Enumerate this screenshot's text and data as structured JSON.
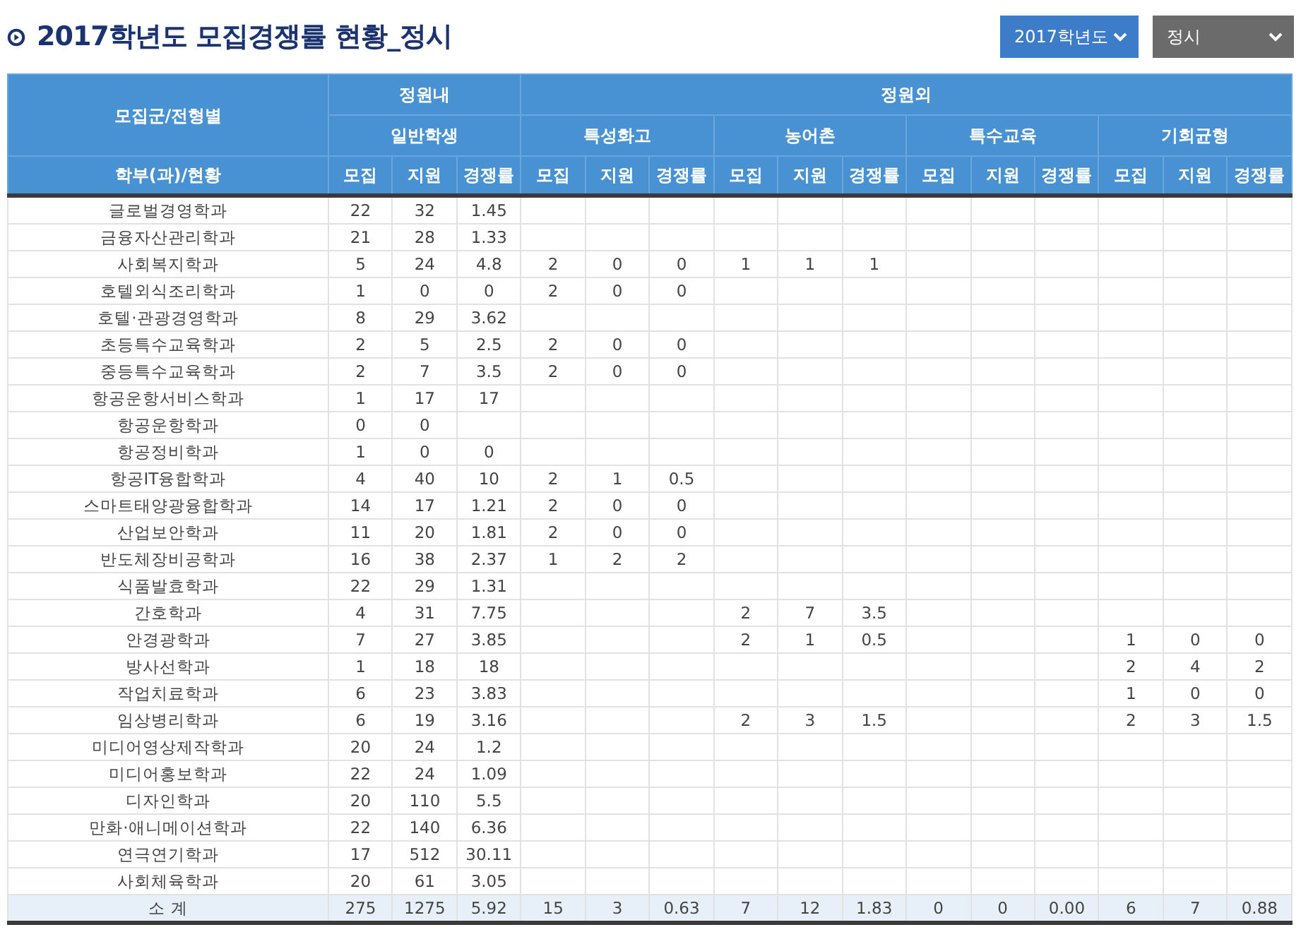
{
  "title": "2017학년도 모집경쟁률 현황_정시",
  "filters": [
    {
      "kind": "year",
      "value": "2017학년도"
    },
    {
      "kind": "type",
      "value": "정시"
    }
  ],
  "table": {
    "corner_top": "모집군/전형별",
    "corner_bottom": "학부(과)/현황",
    "groups": [
      {
        "label": "정원내",
        "subgroups": [
          "일반학생"
        ]
      },
      {
        "label": "정원외",
        "subgroups": [
          "특성화고",
          "농어촌",
          "특수교육",
          "기회균형"
        ]
      }
    ],
    "metrics": [
      "모집",
      "지원",
      "경쟁률",
      "모집",
      "지원",
      "경쟁률",
      "모집",
      "지원",
      "경쟁률",
      "모집",
      "지원",
      "경쟁률",
      "모집",
      "지원",
      "경쟁률"
    ],
    "rows": [
      {
        "name": "글로벌경영학과",
        "cells": [
          "22",
          "32",
          "1.45",
          null,
          null,
          null,
          null,
          null,
          null,
          null,
          null,
          null,
          null,
          null,
          null
        ]
      },
      {
        "name": "금융자산관리학과",
        "cells": [
          "21",
          "28",
          "1.33",
          null,
          null,
          null,
          null,
          null,
          null,
          null,
          null,
          null,
          null,
          null,
          null
        ]
      },
      {
        "name": "사회복지학과",
        "cells": [
          "5",
          "24",
          "4.8",
          "2",
          "0",
          "0",
          "1",
          "1",
          "1",
          null,
          null,
          null,
          null,
          null,
          null
        ]
      },
      {
        "name": "호텔외식조리학과",
        "cells": [
          "1",
          "0",
          "0",
          "2",
          "0",
          "0",
          null,
          null,
          null,
          null,
          null,
          null,
          null,
          null,
          null
        ]
      },
      {
        "name": "호텔·관광경영학과",
        "cells": [
          "8",
          "29",
          "3.62",
          null,
          null,
          null,
          null,
          null,
          null,
          null,
          null,
          null,
          null,
          null,
          null
        ]
      },
      {
        "name": "초등특수교육학과",
        "cells": [
          "2",
          "5",
          "2.5",
          "2",
          "0",
          "0",
          null,
          null,
          null,
          null,
          null,
          null,
          null,
          null,
          null
        ]
      },
      {
        "name": "중등특수교육학과",
        "cells": [
          "2",
          "7",
          "3.5",
          "2",
          "0",
          "0",
          null,
          null,
          null,
          null,
          null,
          null,
          null,
          null,
          null
        ]
      },
      {
        "name": "항공운항서비스학과",
        "cells": [
          "1",
          "17",
          "17",
          null,
          null,
          null,
          null,
          null,
          null,
          null,
          null,
          null,
          null,
          null,
          null
        ]
      },
      {
        "name": "항공운항학과",
        "cells": [
          "0",
          "0",
          null,
          null,
          null,
          null,
          null,
          null,
          null,
          null,
          null,
          null,
          null,
          null,
          null
        ]
      },
      {
        "name": "항공정비학과",
        "cells": [
          "1",
          "0",
          "0",
          null,
          null,
          null,
          null,
          null,
          null,
          null,
          null,
          null,
          null,
          null,
          null
        ]
      },
      {
        "name": "항공IT융합학과",
        "cells": [
          "4",
          "40",
          "10",
          "2",
          "1",
          "0.5",
          null,
          null,
          null,
          null,
          null,
          null,
          null,
          null,
          null
        ]
      },
      {
        "name": "스마트태양광융합학과",
        "cells": [
          "14",
          "17",
          "1.21",
          "2",
          "0",
          "0",
          null,
          null,
          null,
          null,
          null,
          null,
          null,
          null,
          null
        ]
      },
      {
        "name": "산업보안학과",
        "cells": [
          "11",
          "20",
          "1.81",
          "2",
          "0",
          "0",
          null,
          null,
          null,
          null,
          null,
          null,
          null,
          null,
          null
        ]
      },
      {
        "name": "반도체장비공학과",
        "cells": [
          "16",
          "38",
          "2.37",
          "1",
          "2",
          "2",
          null,
          null,
          null,
          null,
          null,
          null,
          null,
          null,
          null
        ]
      },
      {
        "name": "식품발효학과",
        "cells": [
          "22",
          "29",
          "1.31",
          null,
          null,
          null,
          null,
          null,
          null,
          null,
          null,
          null,
          null,
          null,
          null
        ]
      },
      {
        "name": "간호학과",
        "cells": [
          "4",
          "31",
          "7.75",
          null,
          null,
          null,
          "2",
          "7",
          "3.5",
          null,
          null,
          null,
          null,
          null,
          null
        ]
      },
      {
        "name": "안경광학과",
        "cells": [
          "7",
          "27",
          "3.85",
          null,
          null,
          null,
          "2",
          "1",
          "0.5",
          null,
          null,
          null,
          "1",
          "0",
          "0"
        ]
      },
      {
        "name": "방사선학과",
        "cells": [
          "1",
          "18",
          "18",
          null,
          null,
          null,
          null,
          null,
          null,
          null,
          null,
          null,
          "2",
          "4",
          "2"
        ]
      },
      {
        "name": "작업치료학과",
        "cells": [
          "6",
          "23",
          "3.83",
          null,
          null,
          null,
          null,
          null,
          null,
          null,
          null,
          null,
          "1",
          "0",
          "0"
        ]
      },
      {
        "name": "임상병리학과",
        "cells": [
          "6",
          "19",
          "3.16",
          null,
          null,
          null,
          "2",
          "3",
          "1.5",
          null,
          null,
          null,
          "2",
          "3",
          "1.5"
        ]
      },
      {
        "name": "미디어영상제작학과",
        "cells": [
          "20",
          "24",
          "1.2",
          null,
          null,
          null,
          null,
          null,
          null,
          null,
          null,
          null,
          null,
          null,
          null
        ]
      },
      {
        "name": "미디어홍보학과",
        "cells": [
          "22",
          "24",
          "1.09",
          null,
          null,
          null,
          null,
          null,
          null,
          null,
          null,
          null,
          null,
          null,
          null
        ]
      },
      {
        "name": "디자인학과",
        "cells": [
          "20",
          "110",
          "5.5",
          null,
          null,
          null,
          null,
          null,
          null,
          null,
          null,
          null,
          null,
          null,
          null
        ]
      },
      {
        "name": "만화·애니메이션학과",
        "cells": [
          "22",
          "140",
          "6.36",
          null,
          null,
          null,
          null,
          null,
          null,
          null,
          null,
          null,
          null,
          null,
          null
        ]
      },
      {
        "name": "연극연기학과",
        "cells": [
          "17",
          "512",
          "30.11",
          null,
          null,
          null,
          null,
          null,
          null,
          null,
          null,
          null,
          null,
          null,
          null
        ]
      },
      {
        "name": "사회체육학과",
        "cells": [
          "20",
          "61",
          "3.05",
          null,
          null,
          null,
          null,
          null,
          null,
          null,
          null,
          null,
          null,
          null,
          null
        ]
      }
    ],
    "subtotal": {
      "name": "소 계",
      "cells": [
        "275",
        "1275",
        "5.92",
        "15",
        "3",
        "0.63",
        "7",
        "12",
        "1.83",
        "0",
        "0",
        "0.00",
        "6",
        "7",
        "0.88"
      ]
    }
  }
}
